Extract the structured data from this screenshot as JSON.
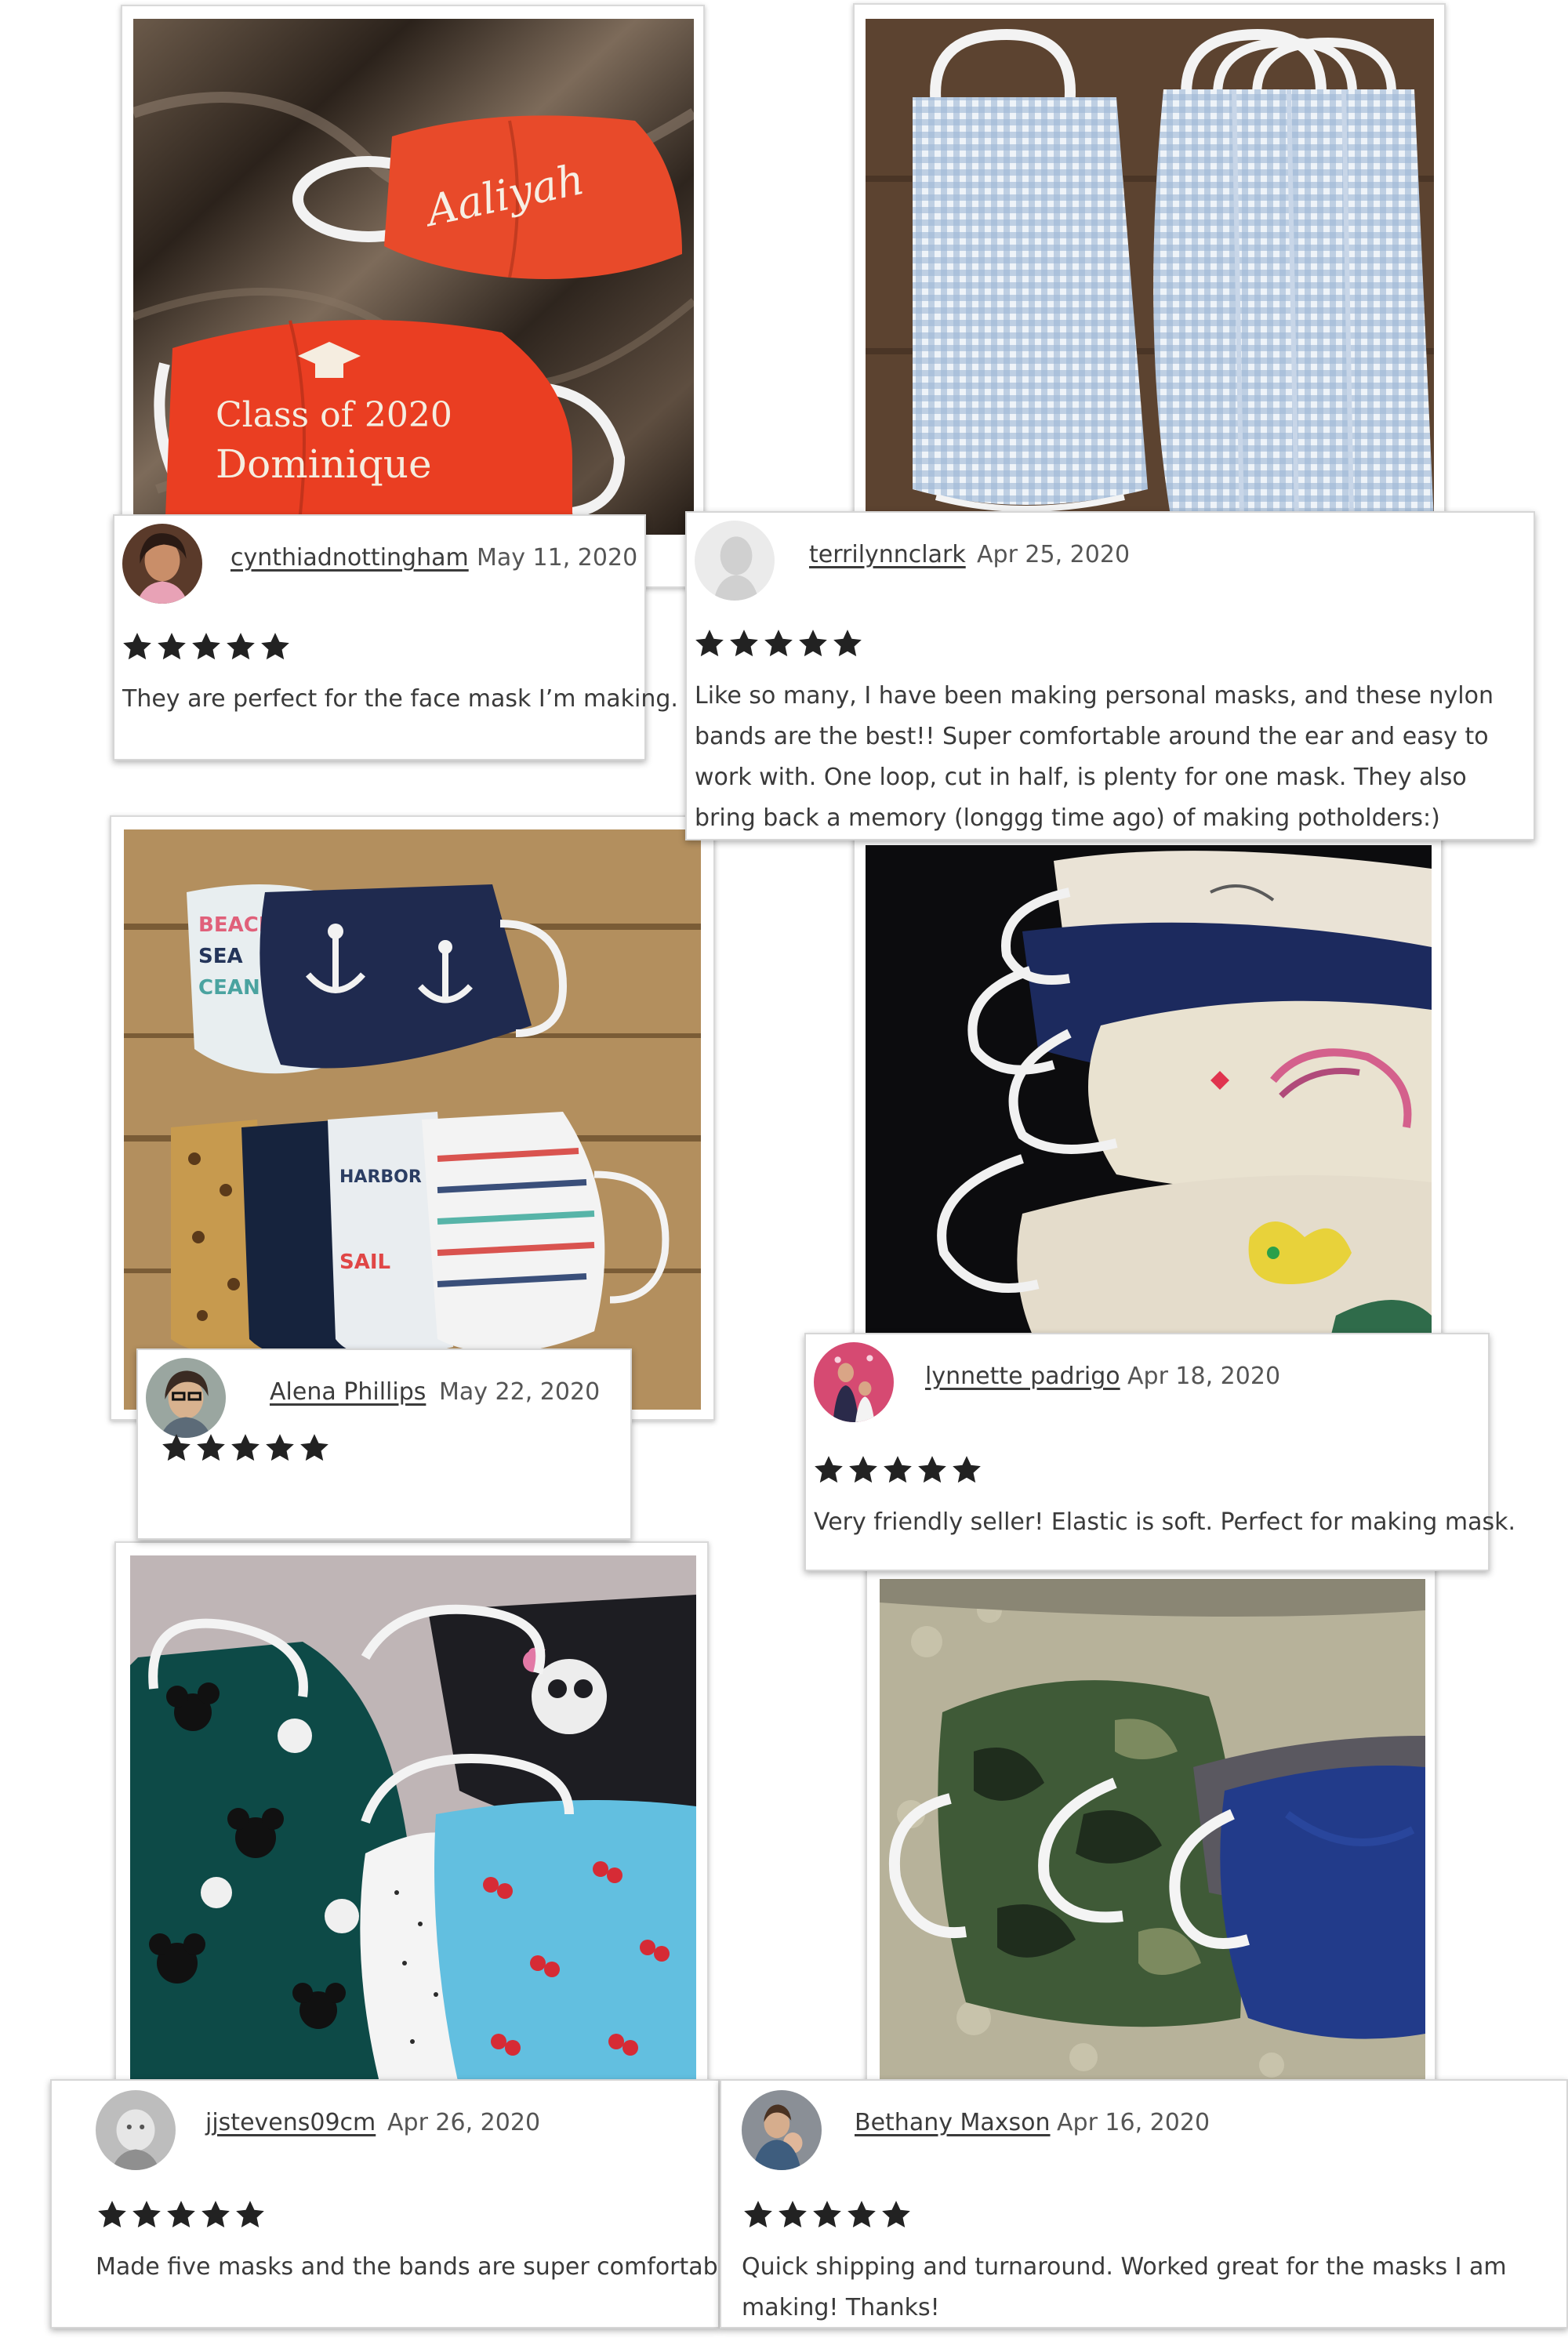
{
  "reviews": [
    {
      "reviewer": "cynthiadnottingham",
      "date": "May 11, 2020",
      "rating": 5,
      "text": "They are perfect for the face mask I’m making."
    },
    {
      "reviewer": "terrilynnclark",
      "date": "Apr 25, 2020",
      "rating": 5,
      "text": "Like so many, I have been making personal masks, and these nylon bands are the best!! Super comfortable around the ear and easy to work with. One loop, cut in half, is plenty for one mask. They also bring back a memory (longgg time ago) of making potholders:)"
    },
    {
      "reviewer": "Alena Phillips",
      "date": "May 22, 2020",
      "rating": 5,
      "text": ""
    },
    {
      "reviewer": "lynnette padrigo",
      "date": "Apr 18, 2020",
      "rating": 5,
      "text": "Very friendly seller! Elastic is soft. Perfect for making mask."
    },
    {
      "reviewer": "jjstevens09cm",
      "date": "Apr 26, 2020",
      "rating": 5,
      "text": "Made five masks and the bands are super comfortable."
    },
    {
      "reviewer": "Bethany Maxson",
      "date": "Apr 16, 2020",
      "rating": 5,
      "text": "Quick shipping and turnaround. Worked great for the masks I am making! Thanks!"
    }
  ],
  "photo_text": {
    "mask_name_1": "Aaliyah",
    "mask_line_1": "Class of 2020",
    "mask_line_2": "Dominique"
  },
  "icons": {
    "star": "filled-star-icon",
    "default_avatar": "person-silhouette-icon"
  },
  "colors": {
    "star": "#222222",
    "name_link": "#3b3b3b",
    "card_border": "#d6d6d6"
  }
}
